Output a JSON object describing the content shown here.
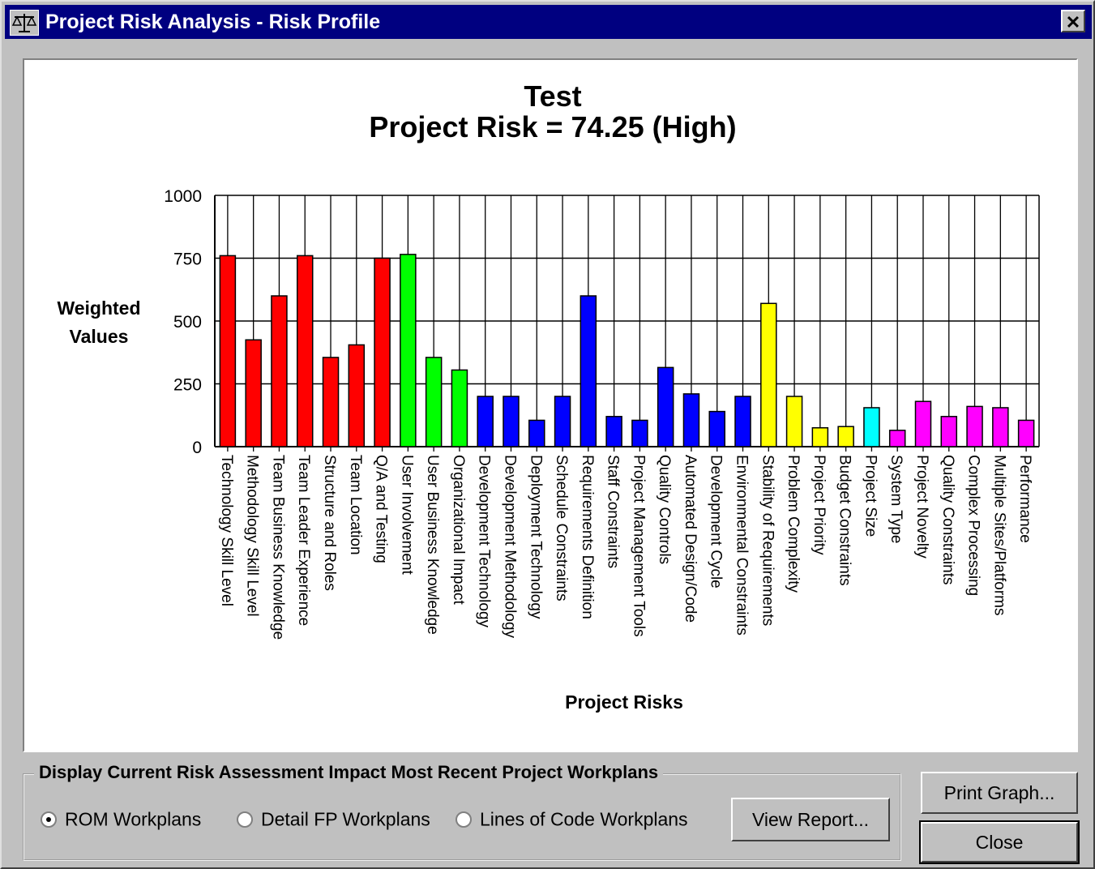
{
  "window": {
    "title": "Project Risk Analysis - Risk Profile",
    "close_glyph": "✕"
  },
  "chart_data": {
    "type": "bar",
    "title": "Test",
    "subtitle": "Project Risk = 74.25 (High)",
    "ylabel": "Weighted Values",
    "xlabel": "Project Risks",
    "ylim": [
      0,
      1000
    ],
    "yticks": [
      0,
      250,
      500,
      750,
      1000
    ],
    "grid": true,
    "categories": [
      "Technology Skill Level",
      "Methodology Skill Level",
      "Team Business Knowledge",
      "Team Leader Experience",
      "Structure and Roles",
      "Team Location",
      "Q/A and Testing",
      "User Involvement",
      "User Business Knowledge",
      "Organizational Impact",
      "Development Technology",
      "Development Methodology",
      "Deployment Technology",
      "Schedule Constraints",
      "Requirements Definition",
      "Staff Constraints",
      "Project Management Tools",
      "Quality Controls",
      "Automated Design/Code",
      "Development Cycle",
      "Environmental Constraints",
      "Stability of Requirements",
      "Problem Complexity",
      "Project Priority",
      "Budget Constraints",
      "Project Size",
      "System Type",
      "Project Novelty",
      "Quality Constraints",
      "Complex Processing",
      "Multiple Sites/Platforms",
      "Performance"
    ],
    "values": [
      760,
      425,
      600,
      760,
      355,
      405,
      750,
      765,
      355,
      305,
      200,
      200,
      105,
      200,
      600,
      120,
      105,
      315,
      210,
      140,
      200,
      570,
      200,
      75,
      80,
      155,
      65,
      180,
      120,
      160,
      155,
      105
    ],
    "colors": [
      "#ff0000",
      "#ff0000",
      "#ff0000",
      "#ff0000",
      "#ff0000",
      "#ff0000",
      "#ff0000",
      "#00ff00",
      "#00ff00",
      "#00ff00",
      "#0000ff",
      "#0000ff",
      "#0000ff",
      "#0000ff",
      "#0000ff",
      "#0000ff",
      "#0000ff",
      "#0000ff",
      "#0000ff",
      "#0000ff",
      "#0000ff",
      "#ffff00",
      "#ffff00",
      "#ffff00",
      "#ffff00",
      "#00ffff",
      "#ff00ff",
      "#ff00ff",
      "#ff00ff",
      "#ff00ff",
      "#ff00ff",
      "#ff00ff"
    ]
  },
  "display_group": {
    "label": "Display Current Risk Assessment Impact Most Recent Project Workplans",
    "options": [
      {
        "label": "ROM Workplans",
        "checked": true
      },
      {
        "label": "Detail FP Workplans",
        "checked": false
      },
      {
        "label": "Lines of Code Workplans",
        "checked": false
      }
    ],
    "view_report": "View Report..."
  },
  "buttons": {
    "print_graph": "Print Graph...",
    "close": "Close"
  }
}
